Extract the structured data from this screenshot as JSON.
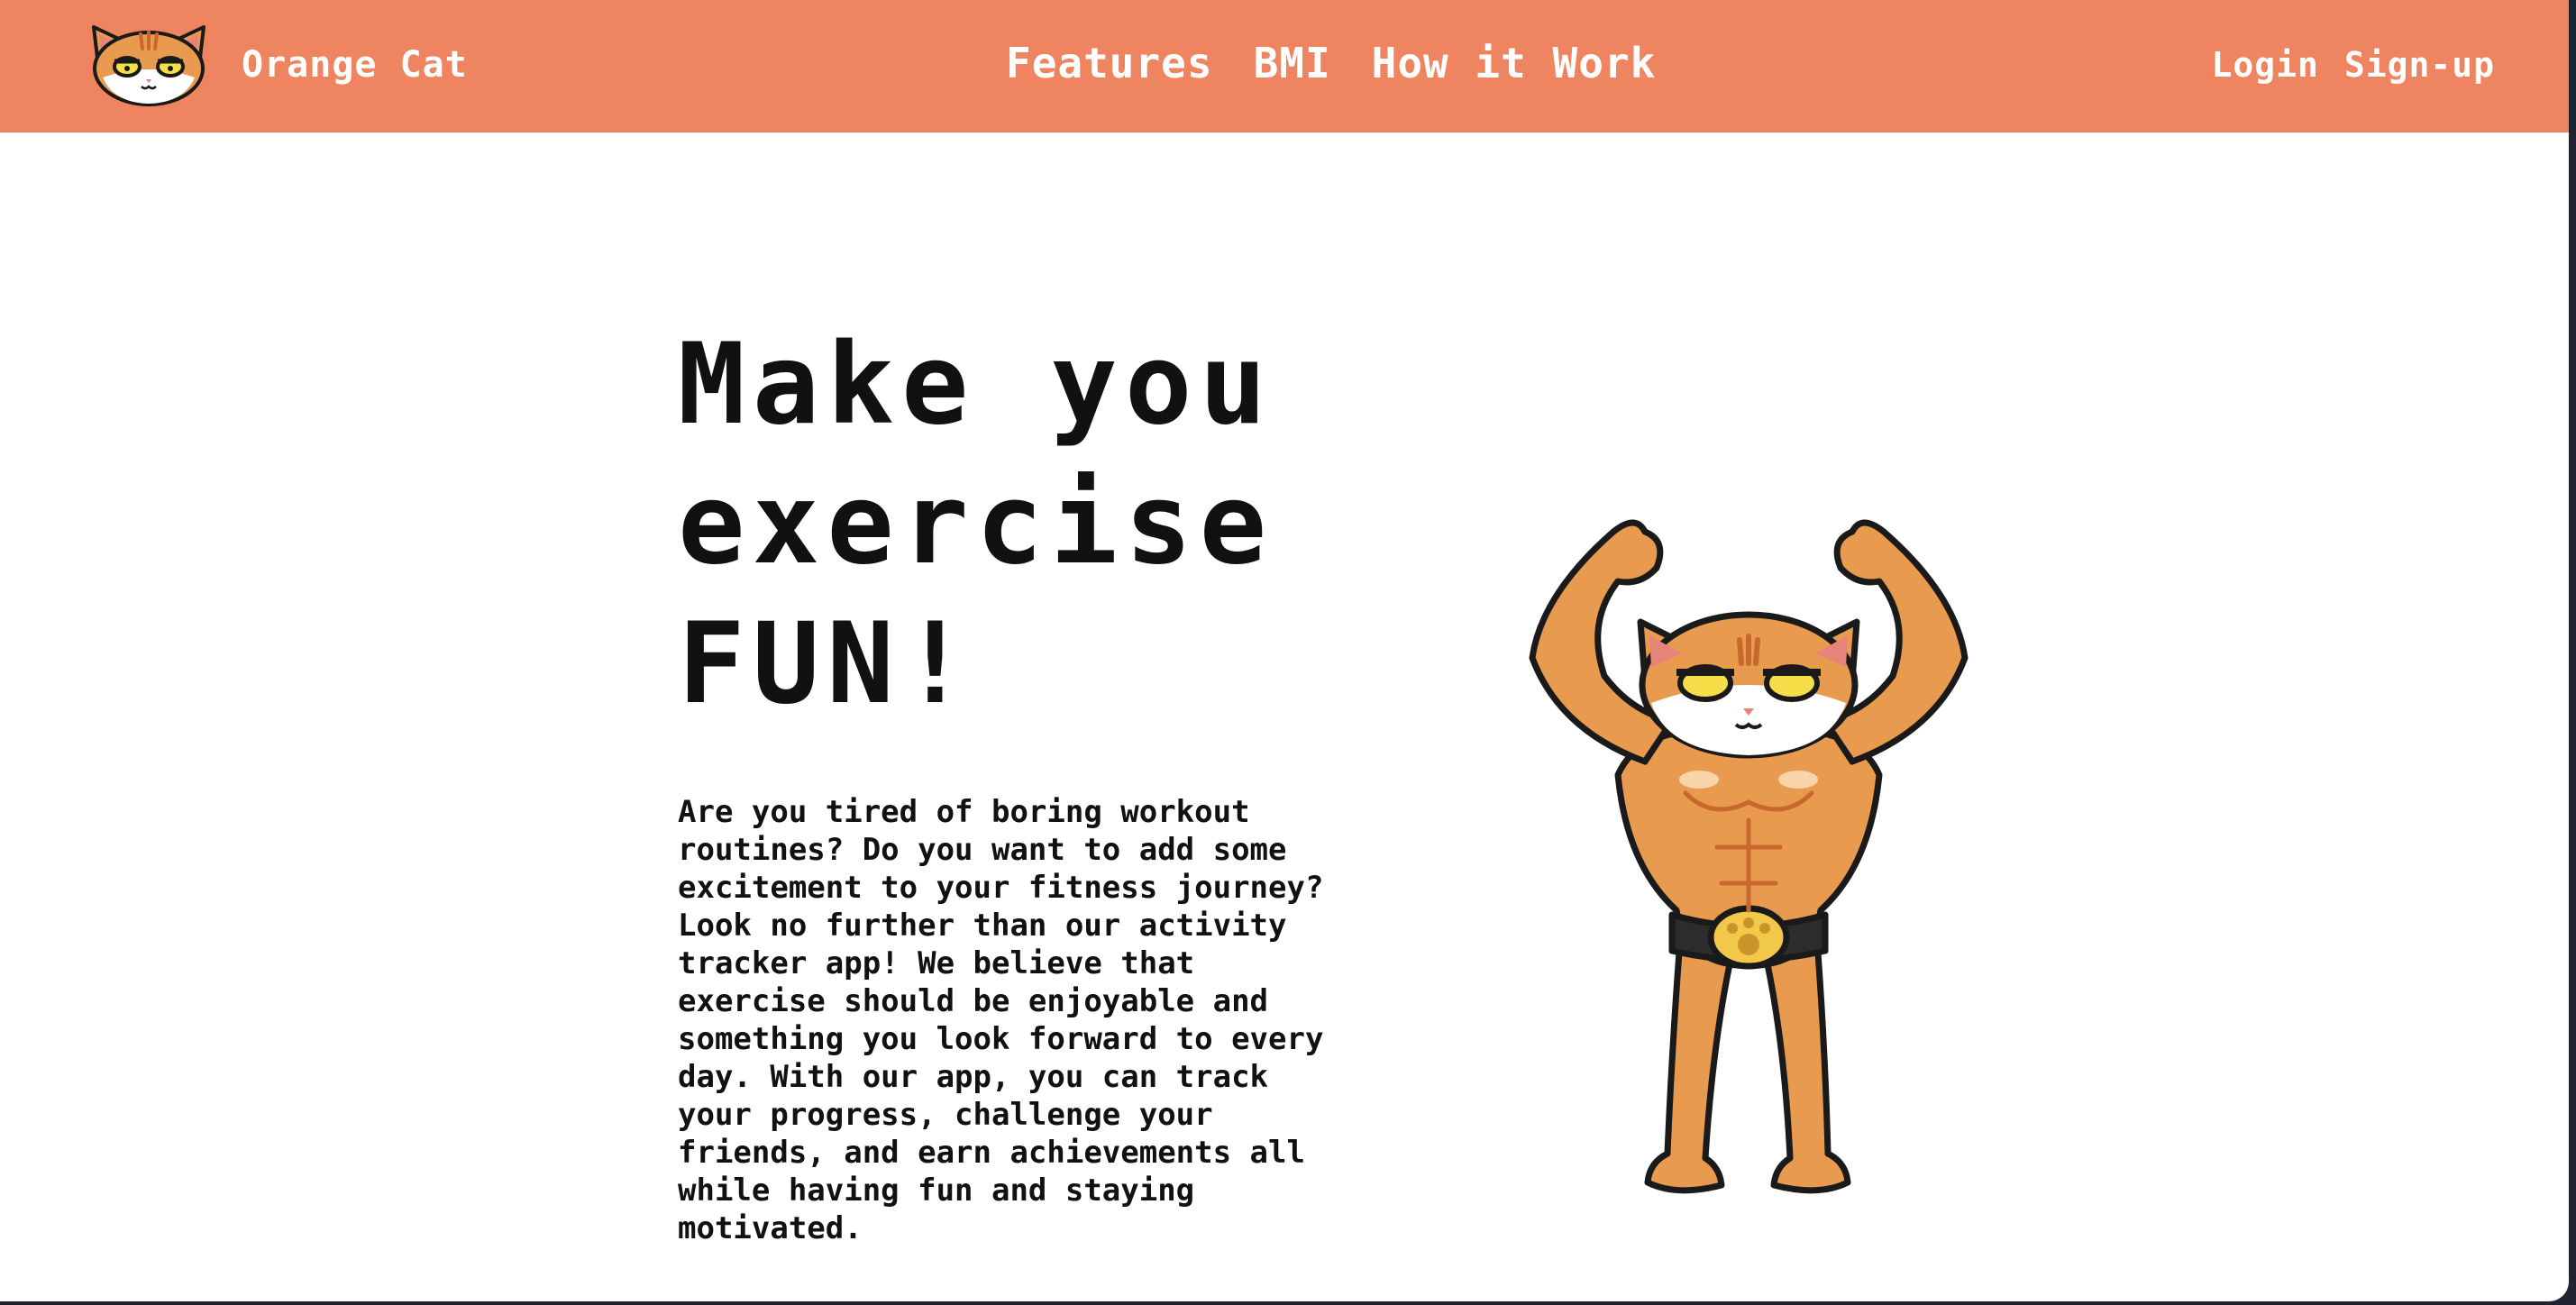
{
  "brand": {
    "name": "Orange Cat",
    "logo_icon": "cat-face-icon"
  },
  "nav": {
    "center": [
      "Features",
      "BMI",
      "How it Work"
    ],
    "right": [
      "Login",
      "Sign-up"
    ]
  },
  "hero": {
    "title_lines": [
      "Make you",
      "exercise",
      "FUN!"
    ],
    "body": "Are you tired of boring workout routines? Do you want to add some excitement to your fitness journey? Look no further than our activity tracker app! We believe that exercise should be enjoyable and something you look forward to every day. With our app, you can track your progress, challenge your friends, and earn achievements all while having fun and staying motivated.",
    "image_icon": "muscular-cat-illustration"
  },
  "colors": {
    "navbar": "#ef8560",
    "nav_text": "#ffffff",
    "page_background": "#ffffff",
    "text": "#111111",
    "cat_body": "#e89a4e",
    "outline": "#1a1a1a"
  }
}
